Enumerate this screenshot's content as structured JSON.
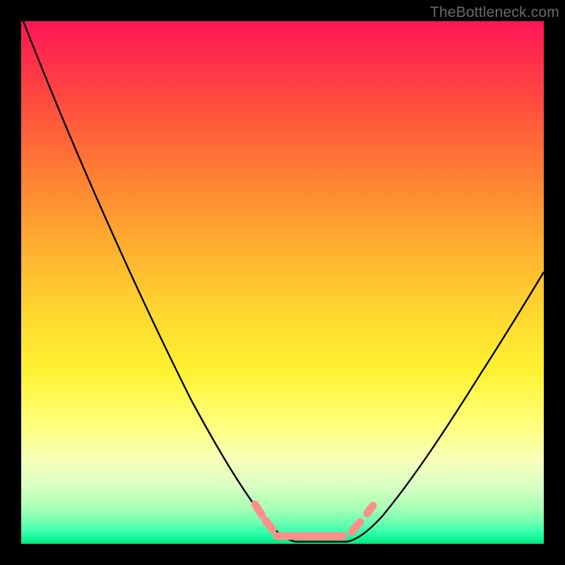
{
  "watermark": "TheBottleneck.com",
  "chart_data": {
    "type": "line",
    "title": "",
    "xlabel": "",
    "ylabel": "",
    "xlim": [
      0,
      100
    ],
    "ylim": [
      0,
      100
    ],
    "grid": false,
    "legend": false,
    "background_gradient": {
      "orientation": "vertical",
      "stops": [
        {
          "pos": 0,
          "color": "#ff1757"
        },
        {
          "pos": 15,
          "color": "#ff4a3f"
        },
        {
          "pos": 42,
          "color": "#ffab30"
        },
        {
          "pos": 67,
          "color": "#fff231"
        },
        {
          "pos": 84,
          "color": "#f7ffb9"
        },
        {
          "pos": 96,
          "color": "#6cffb0"
        },
        {
          "pos": 100,
          "color": "#00e97f"
        }
      ]
    },
    "series": [
      {
        "name": "bottleneck-curve",
        "color": "#000000",
        "x": [
          0,
          4,
          8,
          12,
          16,
          20,
          24,
          28,
          32,
          36,
          40,
          44,
          48,
          50,
          52,
          54,
          56,
          58,
          60,
          62,
          64,
          68,
          72,
          76,
          80,
          84,
          88,
          92,
          96,
          100
        ],
        "y": [
          100,
          92,
          84,
          76,
          68,
          60,
          52,
          44,
          36,
          28,
          21,
          14,
          6,
          2,
          0,
          0,
          0,
          0,
          0,
          1,
          3,
          8,
          14,
          21,
          28,
          35,
          42,
          49,
          56,
          63
        ]
      }
    ],
    "curve_minimum_band": {
      "name": "optimal-region",
      "color": "#ff8f8a",
      "x_range": [
        49,
        63
      ],
      "y": 0
    }
  }
}
